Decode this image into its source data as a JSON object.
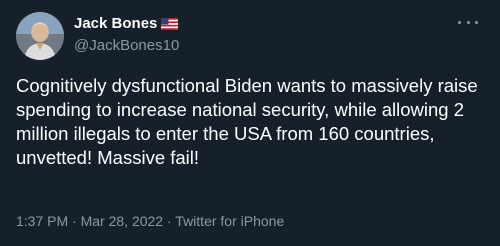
{
  "tweet": {
    "display_name": "Jack Bones",
    "flag": "🇺🇸",
    "handle": "@JackBones10",
    "text": "Cognitively dysfunctional Biden wants to massively raise spending to increase national security, while allowing 2 million illegals to enter the USA from 160 countries, unvetted! Massive fail!",
    "time": "1:37 PM",
    "separator": " · ",
    "date": "Mar 28, 2022",
    "source": "Twitter for iPhone"
  },
  "icons": {
    "more": "more-options-icon",
    "flag": "us-flag-icon"
  },
  "colors": {
    "background": "#15202b",
    "primary_text": "#ffffff",
    "secondary_text": "#8b98a5"
  }
}
